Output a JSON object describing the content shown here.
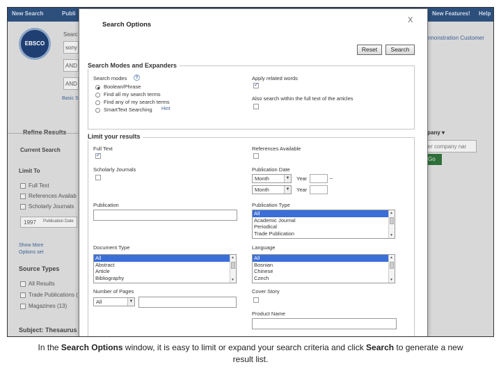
{
  "background": {
    "topbar": [
      "New Search",
      "Publi",
      "New Features!",
      "Help"
    ],
    "logo_text": "EBSCO",
    "search_label": "Searc",
    "search_value": "sony",
    "bool_1": "AND",
    "bool_2": "AND",
    "basic_search": "Basic S",
    "demo_customer": "Demonstration Customer",
    "company_dropdown": "mpany ▾",
    "company_placeholder": "nter company nar",
    "go_label": "Go",
    "refine": "Refine Results",
    "current_search": "Current Search",
    "limit_to": "Limit To",
    "limits": [
      "Full Text",
      "References Availab",
      "Scholarly Journals"
    ],
    "pub_year": "1997",
    "pub_date_label": "Publication Date",
    "show_more": "Show More",
    "options_set": "Options set",
    "source_types": "Source Types",
    "sources": [
      "All Results",
      "Trade Publications (",
      "Magazines (13)"
    ],
    "subject": "Subject: Thesaurus"
  },
  "modal": {
    "title": "Search Options",
    "close": "X",
    "reset": "Reset",
    "search": "Search",
    "modes_section": "Search Modes and Expanders",
    "search_modes_label": "Search modes",
    "help_q": "?",
    "modes": [
      {
        "label": "Boolean/Phrase",
        "selected": true
      },
      {
        "label": "Find all my search terms",
        "selected": false
      },
      {
        "label": "Find any of my search terms",
        "selected": false
      },
      {
        "label": "SmartText Searching",
        "selected": false
      }
    ],
    "smarttext_hint": "Hint",
    "apply_related": "Apply related words",
    "also_search": "Also search within the full text of the articles",
    "limit_section": "Limit your results",
    "full_text": "Full Text",
    "scholarly": "Scholarly Journals",
    "references": "References Available",
    "pub_date": "Publication Date",
    "month": "Month",
    "year": "Year",
    "dash": "–",
    "publication": "Publication",
    "pub_type_label": "Publication Type",
    "pub_types": [
      "All",
      "Academic Journal",
      "Periodical",
      "Trade Publication"
    ],
    "doc_type_label": "Document Type",
    "doc_types": [
      "All",
      "Abstract",
      "Article",
      "Bibliography"
    ],
    "language_label": "Language",
    "languages": [
      "All",
      "Bosnian",
      "Chinese",
      "Czech"
    ],
    "pages_label": "Number of Pages",
    "pages_value": "All",
    "cover_story": "Cover Story",
    "product_name": "Product Name"
  },
  "caption_parts": [
    "In the ",
    "Search Options",
    " window, it is easy to limit or expand your search criteria and click ",
    "Search",
    " to generate a new result list."
  ],
  "colors": {
    "topbar": "#2d4f7c",
    "selected_option": "#3a6fd8",
    "logo": "#1f3f73"
  }
}
